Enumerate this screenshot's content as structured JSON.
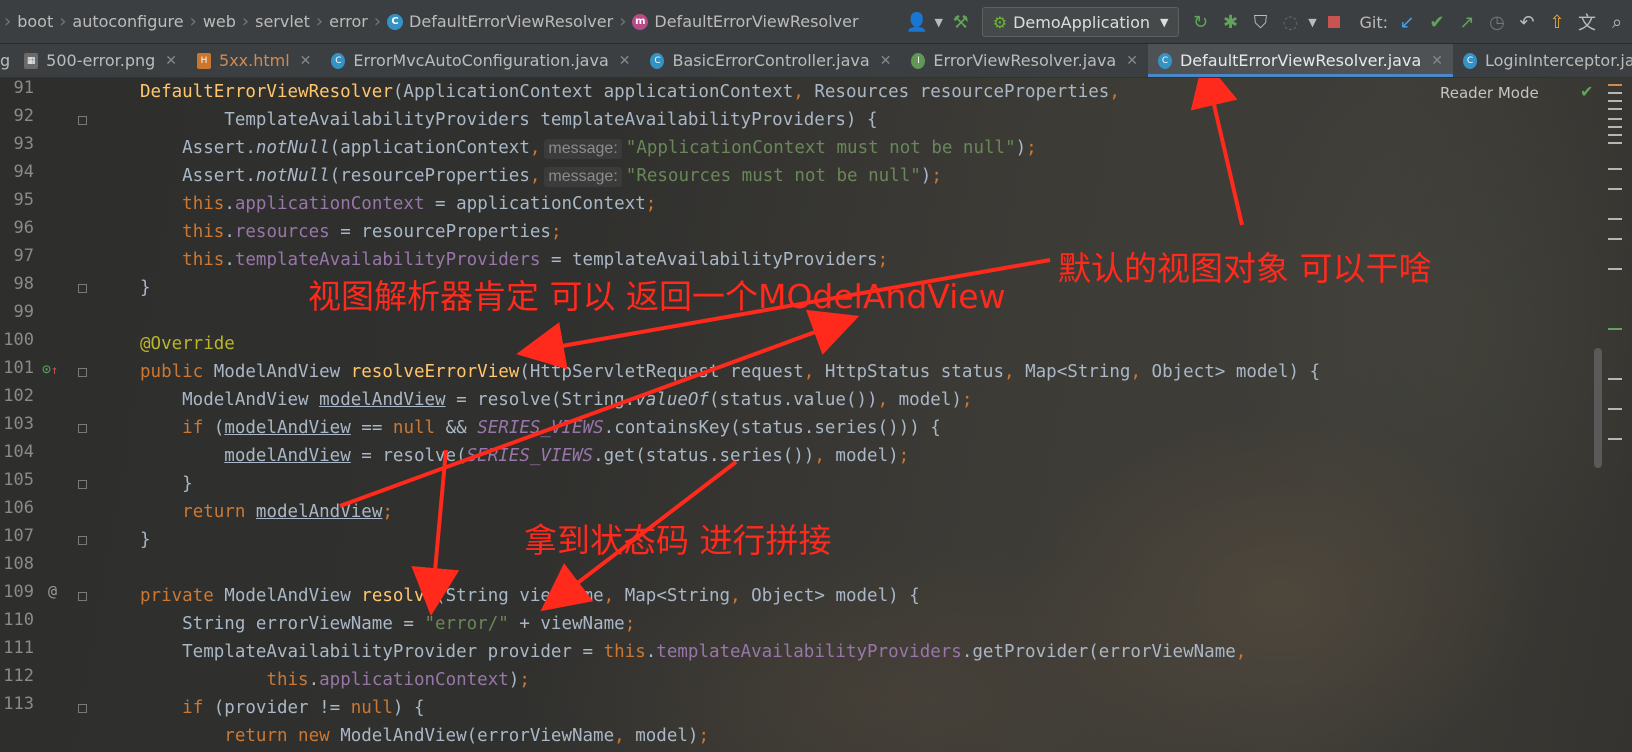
{
  "breadcrumb": {
    "items": [
      {
        "label": "boot",
        "icon": ""
      },
      {
        "label": "autoconfigure",
        "icon": ""
      },
      {
        "label": "web",
        "icon": ""
      },
      {
        "label": "servlet",
        "icon": ""
      },
      {
        "label": "error",
        "icon": ""
      },
      {
        "label": "DefaultErrorViewResolver",
        "icon": "class-icon"
      },
      {
        "label": "DefaultErrorViewResolver",
        "icon": "method-icon"
      }
    ]
  },
  "toolbar": {
    "run_config": "DemoApplication",
    "git_label": "Git:"
  },
  "tabs": [
    {
      "label": "500-error.png",
      "kind": "image",
      "active": false
    },
    {
      "label": "5xx.html",
      "kind": "html",
      "active": false
    },
    {
      "label": "ErrorMvcAutoConfiguration.java",
      "kind": "java",
      "active": false
    },
    {
      "label": "BasicErrorController.java",
      "kind": "java",
      "active": false
    },
    {
      "label": "ErrorViewResolver.java",
      "kind": "java-interface",
      "active": false
    },
    {
      "label": "DefaultErrorViewResolver.java",
      "kind": "java",
      "active": true
    },
    {
      "label": "LoginInterceptor.java",
      "kind": "java",
      "active": false
    }
  ],
  "editor": {
    "reader_mode": "Reader Mode",
    "line_numbers": [
      "91",
      "92",
      "93",
      "94",
      "95",
      "96",
      "97",
      "98",
      "99",
      "100",
      "101",
      "102",
      "103",
      "104",
      "105",
      "106",
      "107",
      "108",
      "109",
      "110",
      "111",
      "112",
      "113"
    ],
    "hints": {
      "message": "message:"
    },
    "strings": {
      "s93": "\"ApplicationContext must not be null\"",
      "s94": "\"Resources must not be null\"",
      "s110": "\"error/\""
    }
  },
  "annotations": {
    "a1": "默认的视图对象 可以干啥",
    "a2": "视图解析器肯定 可以 返回一个MOdelAndView",
    "a3": "拿到状态码 进行拼接"
  }
}
